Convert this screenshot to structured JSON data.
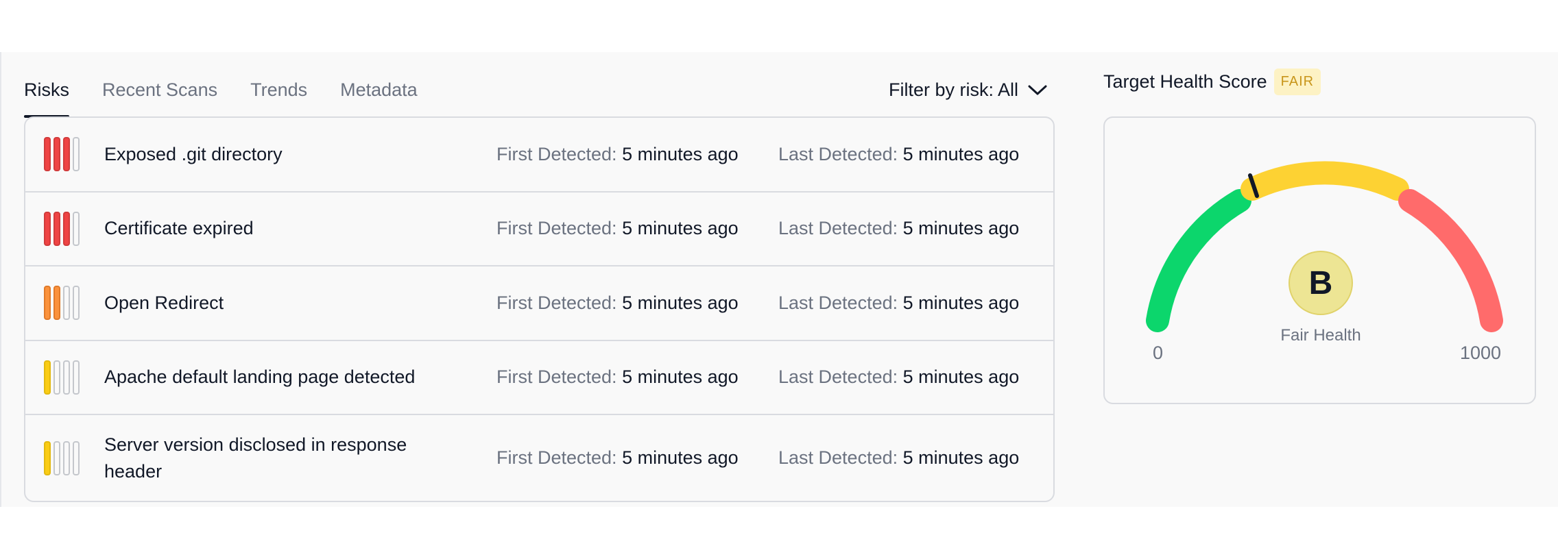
{
  "tabs": [
    {
      "label": "Risks",
      "active": true
    },
    {
      "label": "Recent Scans",
      "active": false
    },
    {
      "label": "Trends",
      "active": false
    },
    {
      "label": "Metadata",
      "active": false
    }
  ],
  "filter": {
    "label": "Filter by risk: All",
    "icon": "chevron-down-icon"
  },
  "risks": {
    "first_label": "First Detected:",
    "last_label": "Last Detected:",
    "items": [
      {
        "name": "Exposed .git directory",
        "first": "5 minutes ago",
        "last": "5 minutes ago",
        "severity_level": 3,
        "color": "#ef4444"
      },
      {
        "name": "Certificate expired",
        "first": "5 minutes ago",
        "last": "5 minutes ago",
        "severity_level": 3,
        "color": "#ef4444"
      },
      {
        "name": "Open Redirect",
        "first": "5 minutes ago",
        "last": "5 minutes ago",
        "severity_level": 2,
        "color": "#fb923c"
      },
      {
        "name": "Apache default landing page detected",
        "first": "5 minutes ago",
        "last": "5 minutes ago",
        "severity_level": 1,
        "color": "#facc15"
      },
      {
        "name": "Server version disclosed in response header",
        "first": "5 minutes ago",
        "last": "5 minutes ago",
        "severity_level": 1,
        "color": "#facc15"
      }
    ]
  },
  "health": {
    "title": "Target Health Score",
    "badge": "FAIR",
    "grade": "B",
    "grade_label": "Fair Health",
    "min": "0",
    "max": "1000",
    "colors": {
      "good": "#0cd66c",
      "fair": "#fdd233",
      "poor": "#ff6b6b"
    }
  }
}
